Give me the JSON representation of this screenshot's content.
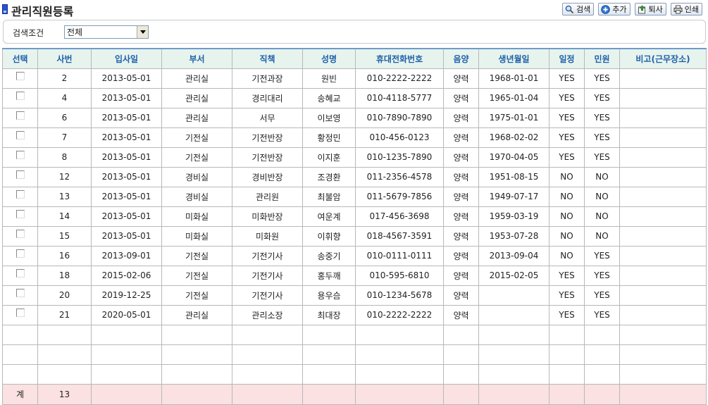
{
  "title": "관리직원등록",
  "toolbar": {
    "search_label": "검색",
    "add_label": "추가",
    "resign_label": "퇴사",
    "print_label": "인쇄"
  },
  "search": {
    "label": "검색조건",
    "selected": "전체"
  },
  "table": {
    "headers": [
      "선택",
      "사번",
      "입사일",
      "부서",
      "직책",
      "성명",
      "휴대전화번호",
      "음양",
      "생년월일",
      "일정",
      "민원",
      "비고(근무장소)"
    ],
    "rows": [
      [
        "2",
        "2013-05-01",
        "관리실",
        "기전과장",
        "원빈",
        "010-2222-2222",
        "양력",
        "1968-01-01",
        "YES",
        "YES",
        ""
      ],
      [
        "4",
        "2013-05-01",
        "관리실",
        "경리대리",
        "송혜교",
        "010-4118-5777",
        "양력",
        "1965-01-04",
        "YES",
        "YES",
        ""
      ],
      [
        "6",
        "2013-05-01",
        "관리실",
        "서무",
        "이보영",
        "010-7890-7890",
        "양력",
        "1975-01-01",
        "YES",
        "YES",
        ""
      ],
      [
        "7",
        "2013-05-01",
        "기전실",
        "기전반장",
        "황정민",
        "010-456-0123",
        "양력",
        "1968-02-02",
        "YES",
        "YES",
        ""
      ],
      [
        "8",
        "2013-05-01",
        "기전실",
        "기전반장",
        "이지훈",
        "010-1235-7890",
        "양력",
        "1970-04-05",
        "YES",
        "YES",
        ""
      ],
      [
        "12",
        "2013-05-01",
        "경비실",
        "경비반장",
        "조경환",
        "011-2356-4578",
        "양력",
        "1951-08-15",
        "NO",
        "NO",
        ""
      ],
      [
        "13",
        "2013-05-01",
        "경비실",
        "관리원",
        "최불암",
        "011-5679-7856",
        "양력",
        "1949-07-17",
        "NO",
        "NO",
        ""
      ],
      [
        "14",
        "2013-05-01",
        "미화실",
        "미화반장",
        "여운계",
        "017-456-3698",
        "양력",
        "1959-03-19",
        "NO",
        "NO",
        ""
      ],
      [
        "15",
        "2013-05-01",
        "미화실",
        "미화원",
        "이휘향",
        "018-4567-3591",
        "양력",
        "1953-07-28",
        "NO",
        "NO",
        ""
      ],
      [
        "16",
        "2013-09-01",
        "기전실",
        "기전기사",
        "송중기",
        "010-0111-0111",
        "양력",
        "2013-09-04",
        "NO",
        "YES",
        ""
      ],
      [
        "18",
        "2015-02-06",
        "기전실",
        "기전기사",
        "홍두깨",
        "010-595-6810",
        "양력",
        "2015-02-05",
        "YES",
        "YES",
        ""
      ],
      [
        "20",
        "2019-12-25",
        "기전실",
        "기전기사",
        "용우슴",
        "010-1234-5678",
        "양력",
        "",
        "YES",
        "YES",
        ""
      ],
      [
        "21",
        "2020-05-01",
        "관리실",
        "관리소장",
        "최대장",
        "010-2222-2222",
        "양력",
        "",
        "YES",
        "YES",
        ""
      ]
    ],
    "empty_rows": 3,
    "footer": {
      "label": "계",
      "count": "13"
    }
  },
  "colors": {
    "header_bg": "#e7f4ee",
    "header_text": "#1e5fa8",
    "footer_bg": "#fbe1e1"
  }
}
